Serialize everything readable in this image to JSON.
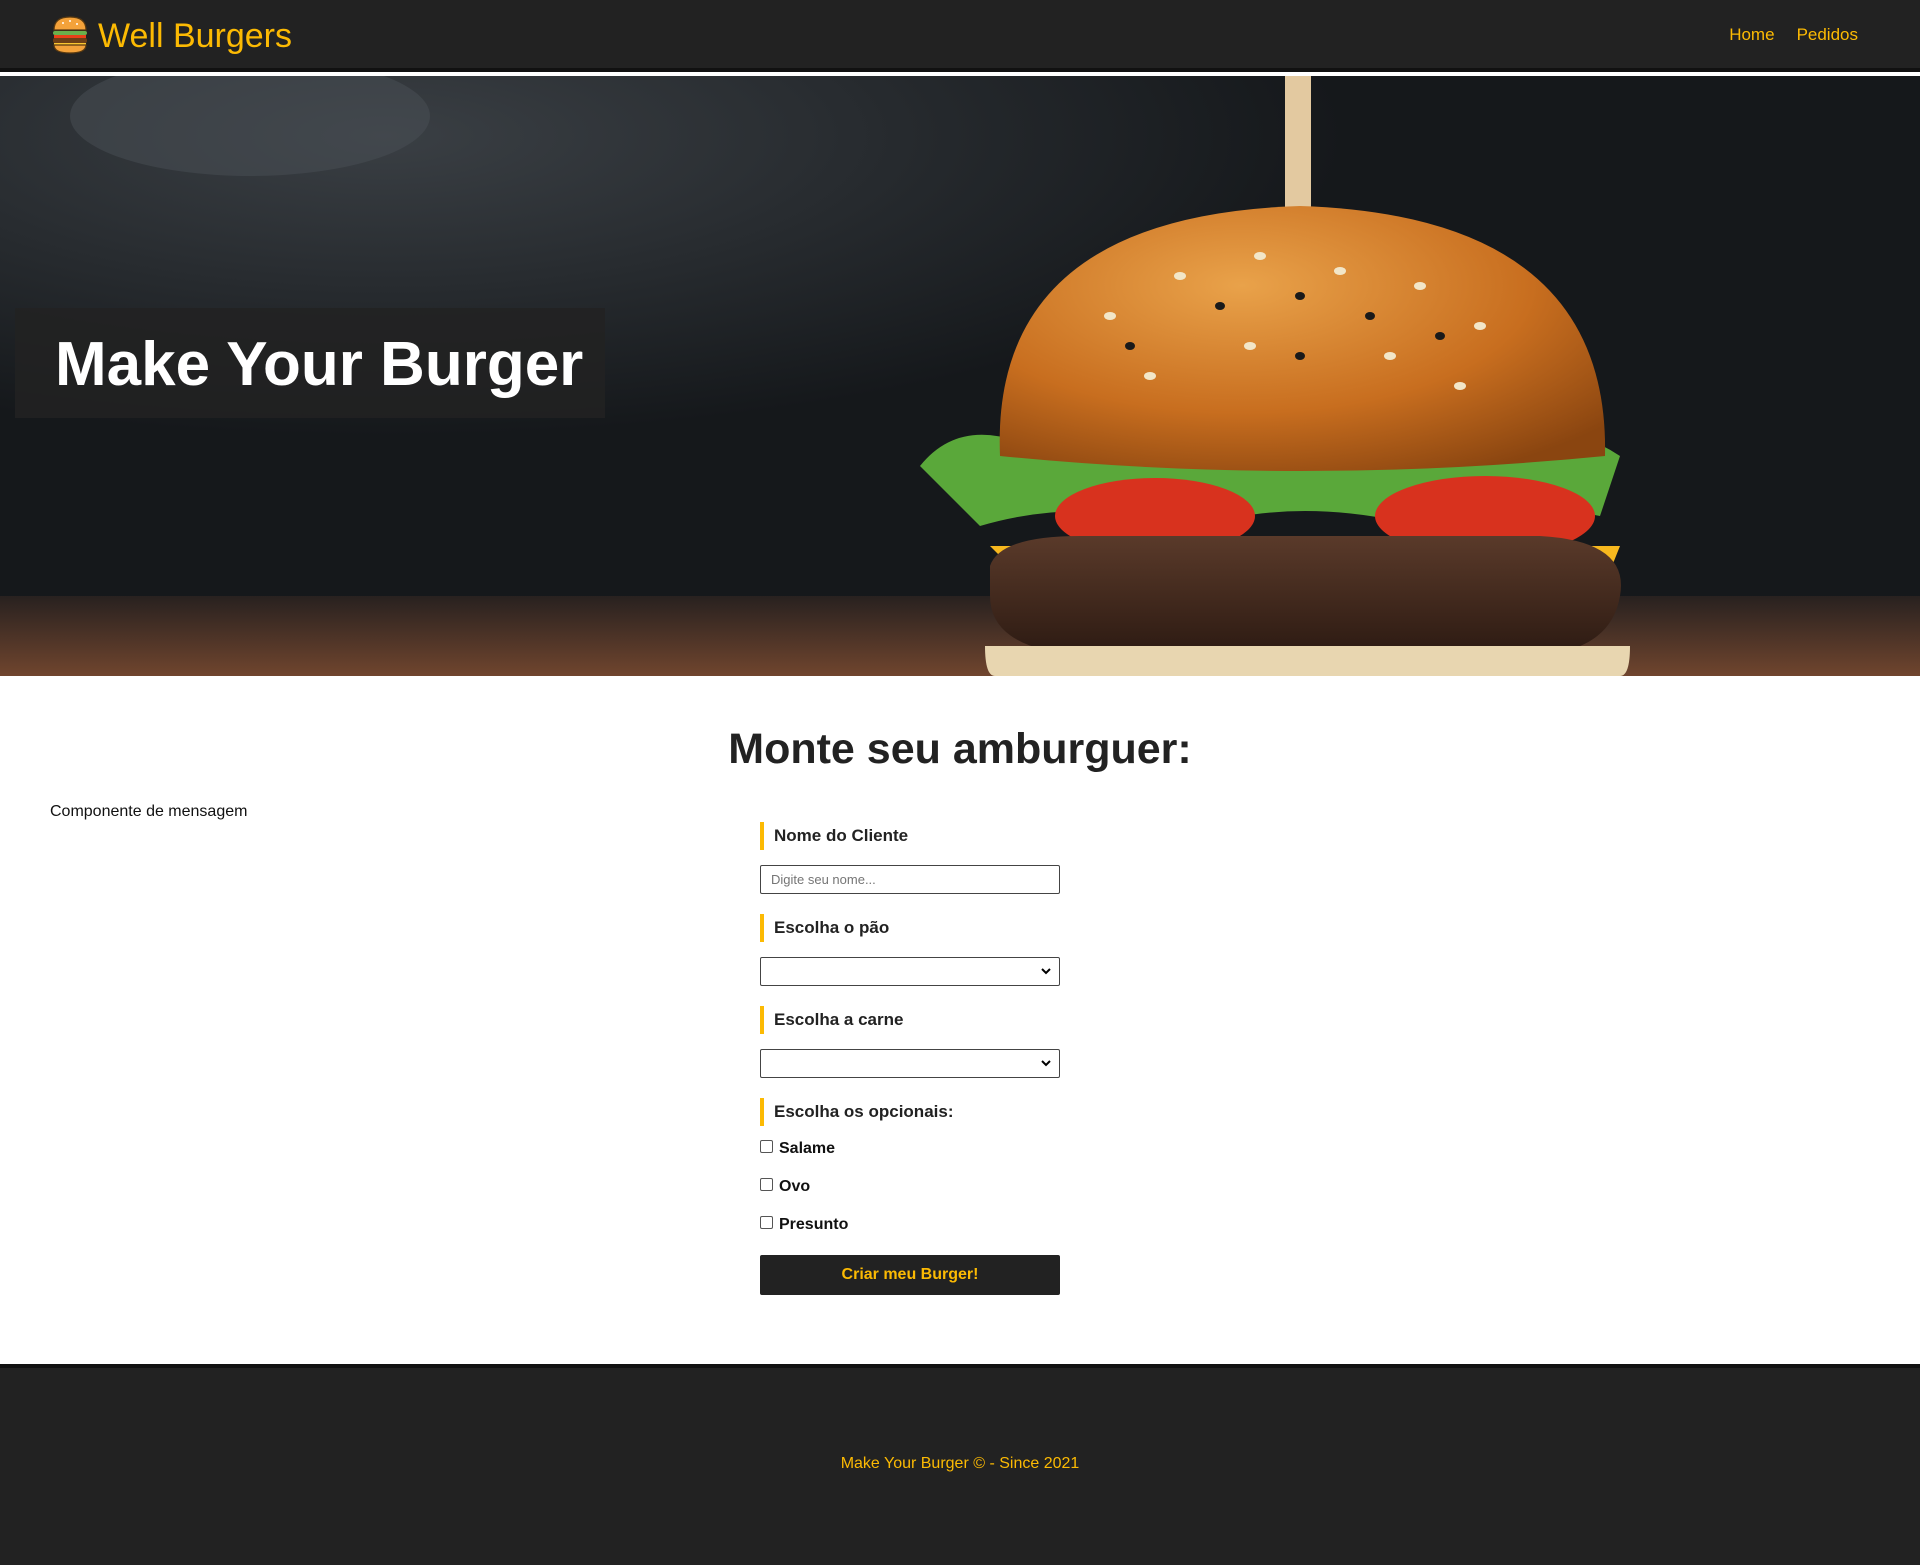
{
  "colors": {
    "accent": "#fcba03",
    "dark": "#222222",
    "white": "#ffffff"
  },
  "navbar": {
    "logo_icon": "burger-icon",
    "brand": "Well Burgers",
    "links": [
      {
        "label": "Home"
      },
      {
        "label": "Pedidos"
      }
    ]
  },
  "hero": {
    "title": "Make Your Burger",
    "image": "burger-photo"
  },
  "main": {
    "title": "Monte seu amburguer:",
    "message_placeholder": "Componente de mensagem"
  },
  "form": {
    "name_label": "Nome do Cliente",
    "name_placeholder": "Digite seu nome...",
    "name_value": "",
    "bread_label": "Escolha o pão",
    "bread_value": "",
    "meat_label": "Escolha a carne",
    "meat_value": "",
    "optionals_label": "Escolha os opcionais:",
    "optionals": [
      {
        "label": "Salame",
        "checked": false
      },
      {
        "label": "Ovo",
        "checked": false
      },
      {
        "label": "Presunto",
        "checked": false
      }
    ],
    "submit_label": "Criar meu Burger!"
  },
  "footer": {
    "text": "Make Your Burger © - Since 2021"
  }
}
